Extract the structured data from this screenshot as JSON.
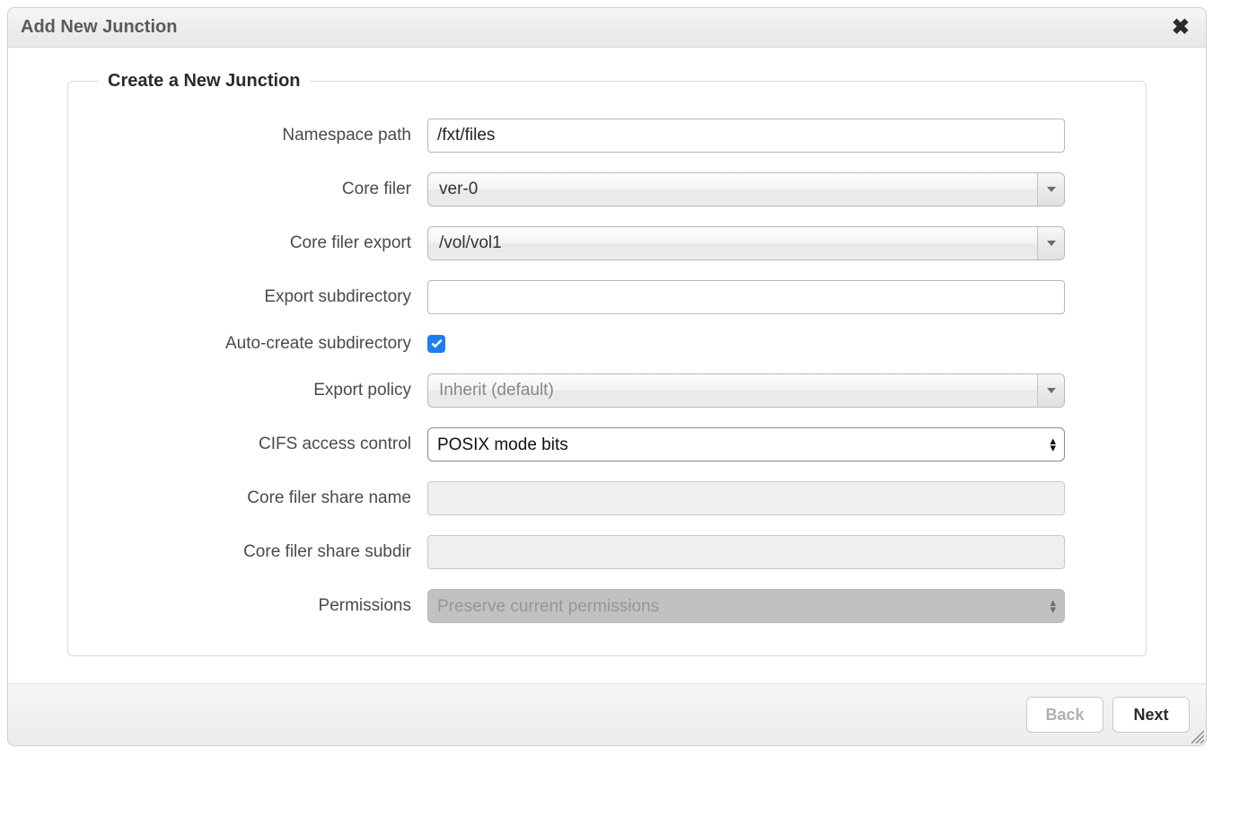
{
  "dialog": {
    "title": "Add New Junction"
  },
  "fieldset": {
    "legend": "Create a New Junction"
  },
  "labels": {
    "namespace_path": "Namespace path",
    "core_filer": "Core filer",
    "core_filer_export": "Core filer export",
    "export_subdirectory": "Export subdirectory",
    "auto_create_subdirectory": "Auto-create subdirectory",
    "export_policy": "Export policy",
    "cifs_access_control": "CIFS access control",
    "core_filer_share_name": "Core filer share name",
    "core_filer_share_subdir": "Core filer share subdir",
    "permissions": "Permissions"
  },
  "values": {
    "namespace_path": "/fxt/files",
    "core_filer": "ver-0",
    "core_filer_export": "/vol/vol1",
    "export_subdirectory": "",
    "auto_create_subdirectory": true,
    "export_policy": "Inherit (default)",
    "cifs_access_control": "POSIX mode bits",
    "core_filer_share_name": "",
    "core_filer_share_subdir": "",
    "permissions": "Preserve current permissions"
  },
  "buttons": {
    "back": "Back",
    "next": "Next"
  }
}
